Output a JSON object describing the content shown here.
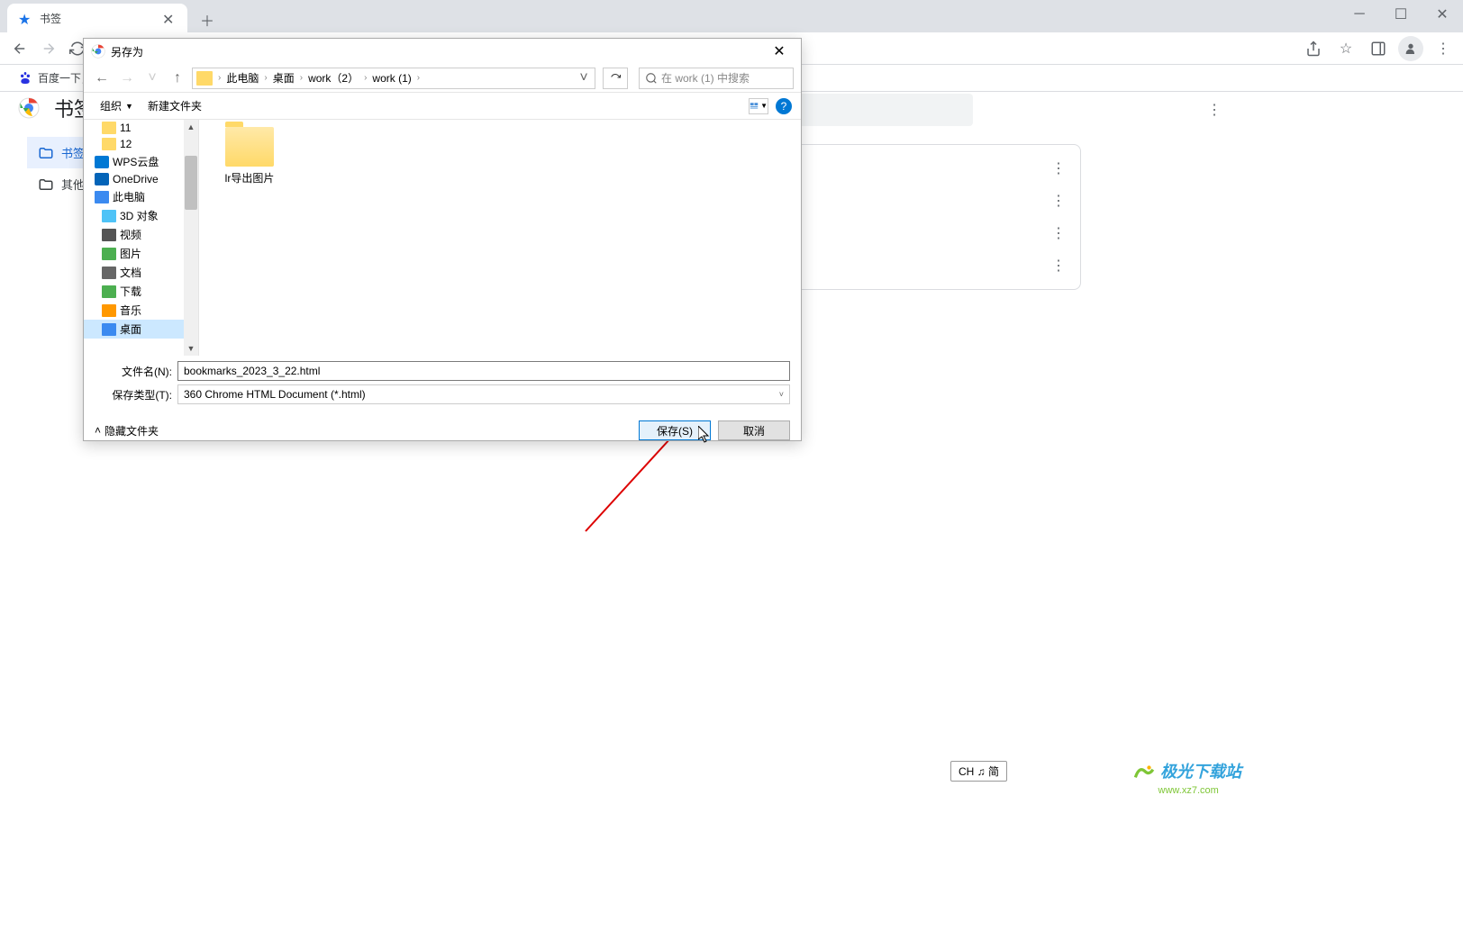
{
  "browser": {
    "tab": {
      "title": "书签"
    },
    "bookmarks_bar": {
      "item1": "百度一下，你"
    }
  },
  "page": {
    "title": "书签",
    "sidebar": {
      "item1": "书签",
      "item2": "其他"
    }
  },
  "dialog": {
    "title": "另存为",
    "breadcrumb": [
      "此电脑",
      "桌面",
      "work（2）",
      "work (1)"
    ],
    "search_placeholder": "在 work (1) 中搜索",
    "toolbar": {
      "organize": "组织",
      "new_folder": "新建文件夹"
    },
    "tree": {
      "i0": "11",
      "i1": "12",
      "i2": "WPS云盘",
      "i3": "OneDrive",
      "i4": "此电脑",
      "i5": "3D 对象",
      "i6": "视频",
      "i7": "图片",
      "i8": "文档",
      "i9": "下载",
      "i10": "音乐",
      "i11": "桌面"
    },
    "files": {
      "f0": "lr导出图片"
    },
    "filename_label": "文件名(N):",
    "filename_value": "bookmarks_2023_3_22.html",
    "filetype_label": "保存类型(T):",
    "filetype_value": "360 Chrome HTML Document (*.html)",
    "hide_folders": "隐藏文件夹",
    "save_btn": "保存(S)",
    "cancel_btn": "取消"
  },
  "ime": "CH ♫ 简",
  "watermark": {
    "main": "极光下载站",
    "sub": "www.xz7.com"
  }
}
